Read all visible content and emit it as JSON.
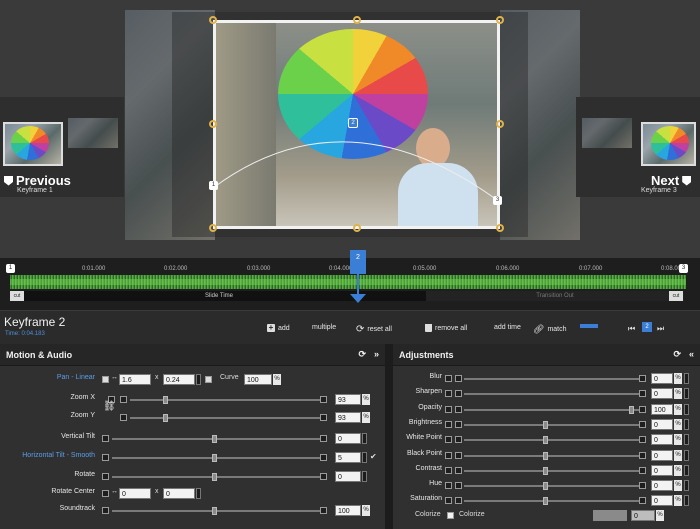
{
  "preview": {
    "previous": {
      "title": "Previous",
      "subtitle": "Keyframe 1"
    },
    "next": {
      "title": "Next",
      "subtitle": "Keyframe 3"
    }
  },
  "timeline": {
    "ticks": [
      "0:01.000",
      "0:02.000",
      "0:03.000",
      "0:04.000",
      "0:05.000",
      "0:06.000",
      "0:07.000",
      "0:08.000"
    ],
    "slide_time_label": "Slide Time",
    "transition_out_label": "Transition Out",
    "start_marker": "1",
    "playhead_marker": "2",
    "end_marker": "3",
    "start_cut": "cut",
    "end_cut": "cut"
  },
  "keyframe": {
    "title": "Keyframe 2",
    "time": "Time: 0:04.183",
    "toolbar": {
      "add": "add",
      "multiple": "multiple",
      "reset_all": "reset all",
      "remove_all": "remove all",
      "add_time": "add time",
      "match": "match",
      "current": "2"
    }
  },
  "motion": {
    "title": "Motion & Audio",
    "rows": [
      {
        "label": "Pan - Linear",
        "x": "1.6",
        "sep": "x",
        "y": "0.24",
        "curve_label": "Curve",
        "curve": "100",
        "pct": "%"
      },
      {
        "label": "Zoom X",
        "value": "93",
        "pct": "%"
      },
      {
        "label": "Zoom Y",
        "value": "93",
        "pct": "%"
      },
      {
        "label": "Vertical Tilt",
        "value": "0"
      },
      {
        "label": "Horizontal Tilt - Smooth",
        "value": "5"
      },
      {
        "label": "Rotate",
        "value": "0"
      },
      {
        "label": "Rotate Center",
        "x": "0",
        "sep": "x",
        "y": "0"
      },
      {
        "label": "Soundtrack",
        "value": "100",
        "pct": "%"
      }
    ]
  },
  "adjust": {
    "title": "Adjustments",
    "rows": [
      {
        "label": "Blur",
        "value": "0",
        "pct": "%"
      },
      {
        "label": "Sharpen",
        "value": "0",
        "pct": "%"
      },
      {
        "label": "Opacity",
        "value": "100",
        "pct": "%"
      },
      {
        "label": "Brightness",
        "value": "0",
        "pct": "%"
      },
      {
        "label": "White Point",
        "value": "0",
        "pct": "%"
      },
      {
        "label": "Black Point",
        "value": "0",
        "pct": "%"
      },
      {
        "label": "Contrast",
        "value": "0",
        "pct": "%"
      },
      {
        "label": "Hue",
        "value": "0",
        "pct": "%"
      },
      {
        "label": "Saturation",
        "value": "0",
        "pct": "%"
      }
    ],
    "colorize_label": "Colorize",
    "colorize_checkbox_label": "Colorize",
    "colorize_value": "0",
    "colorize_pct": "%"
  }
}
